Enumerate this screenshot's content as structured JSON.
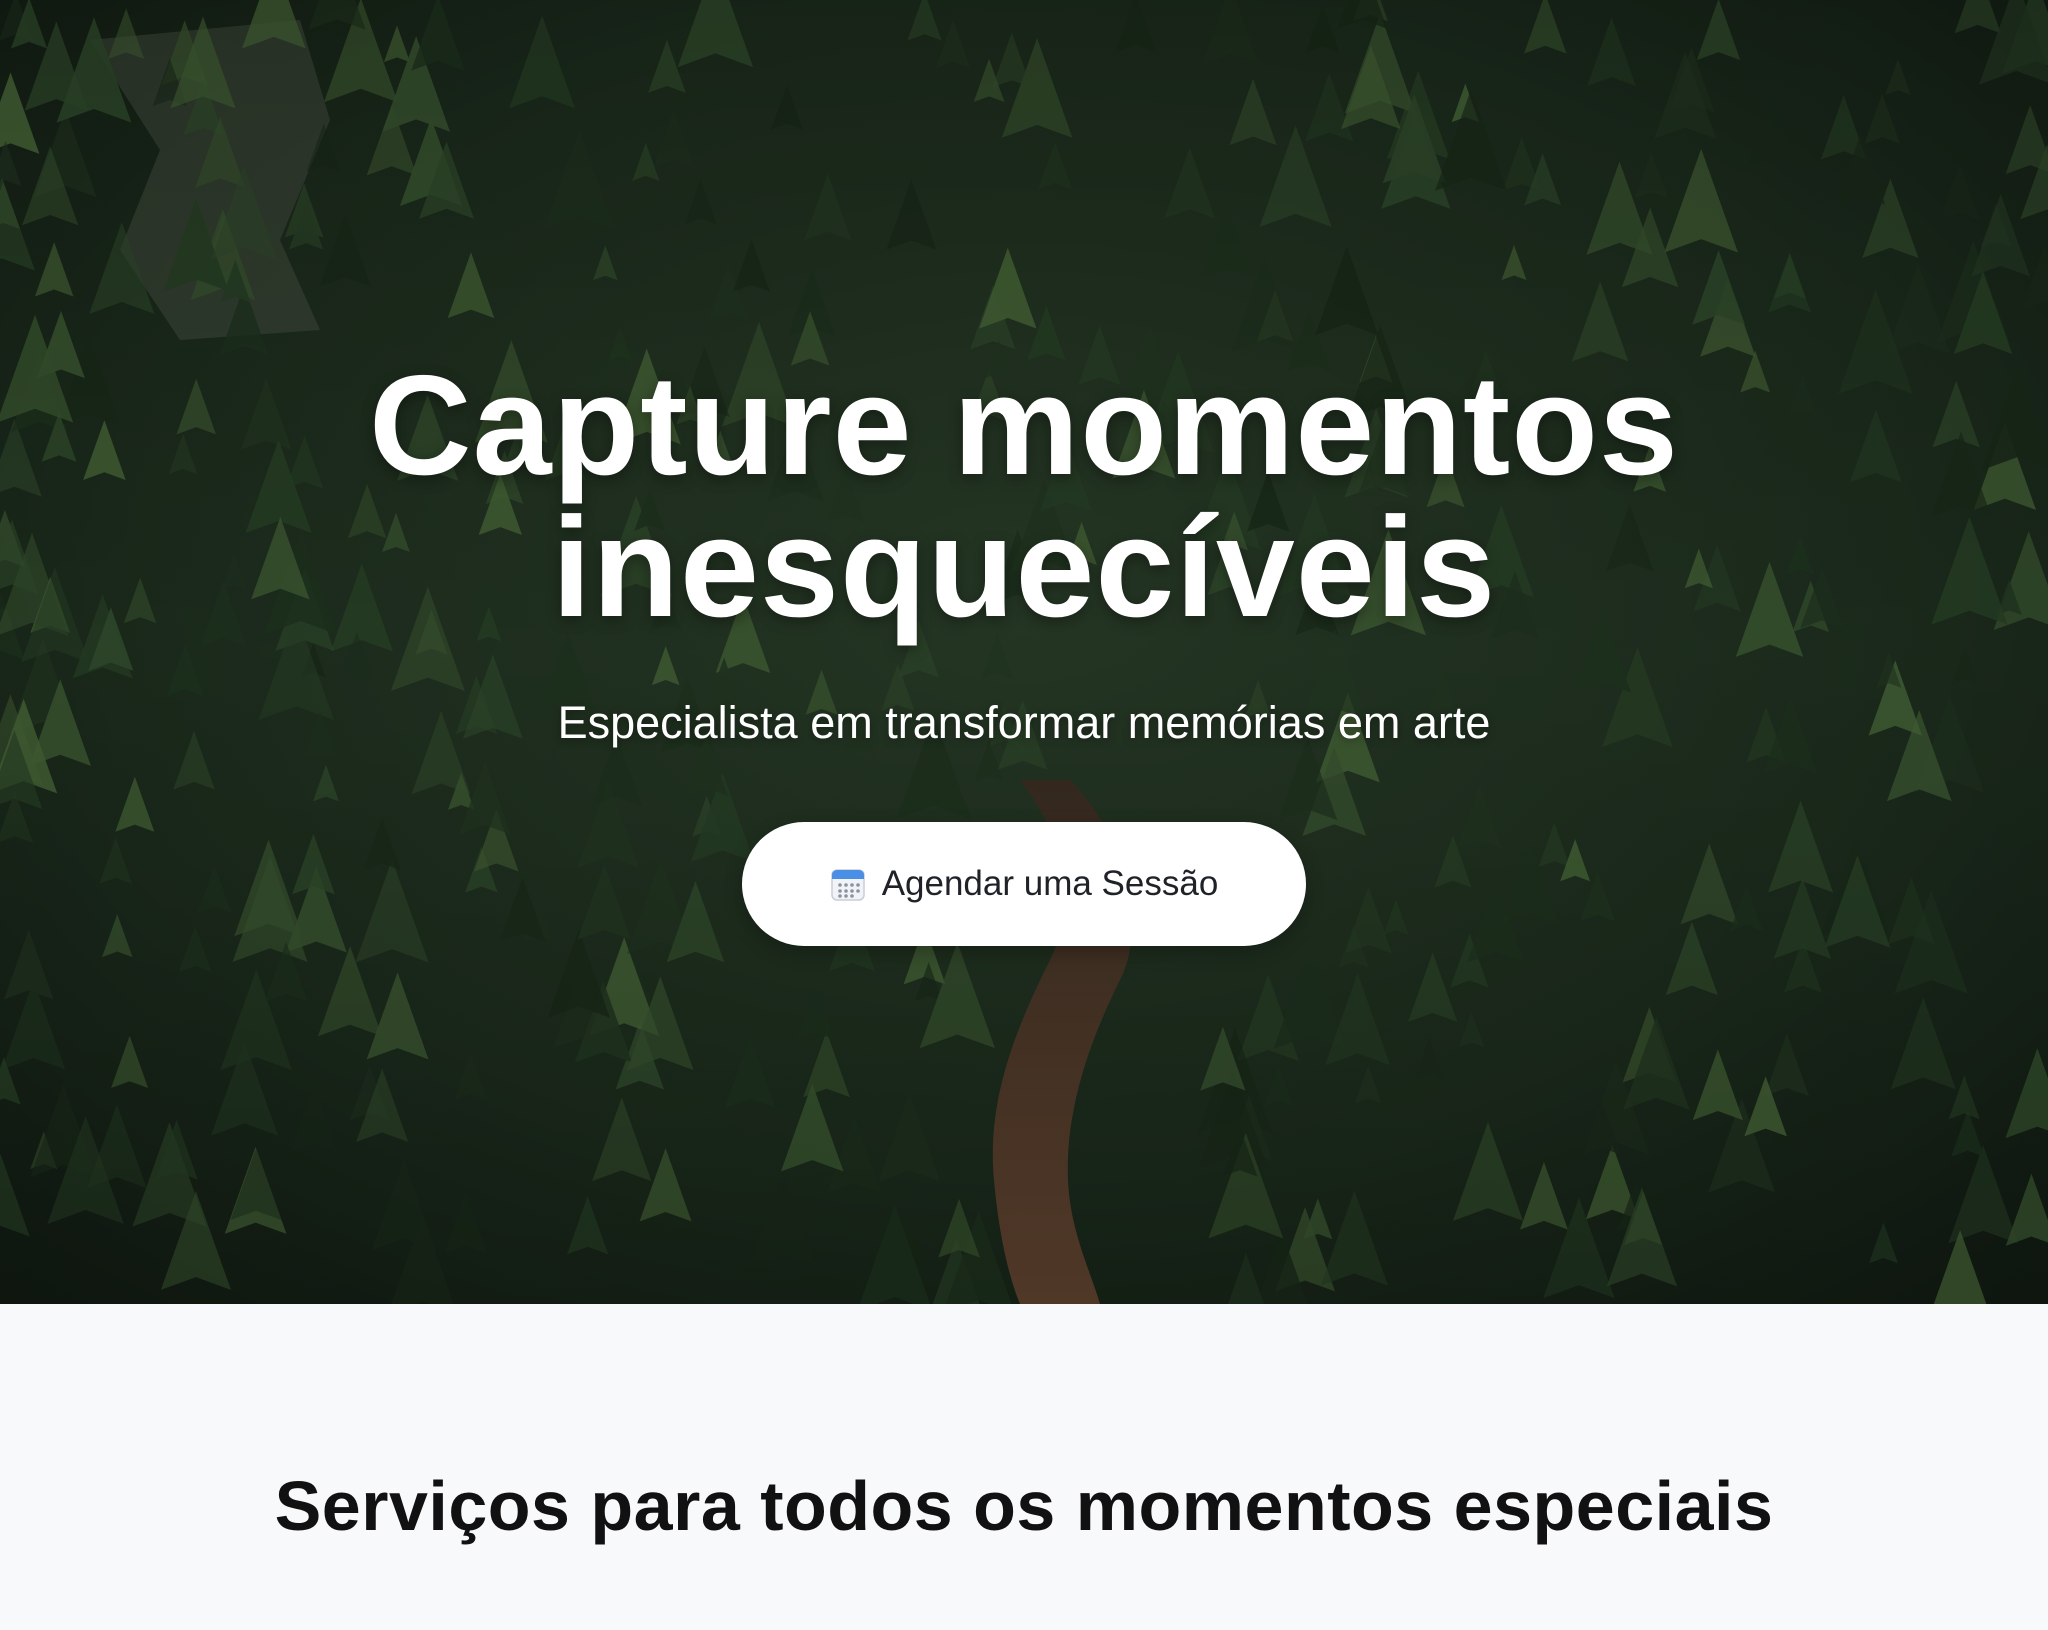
{
  "hero": {
    "title_line1": "Capture momentos",
    "title_line2": "inesquecíveis",
    "subtitle": "Especialista em transformar memórias em arte",
    "cta": {
      "label": "Agendar uma Sessão",
      "icon": "calendar-icon"
    }
  },
  "services": {
    "title": "Serviços para todos os momentos especiais"
  },
  "colors": {
    "forest_dark": "#1a2a1c",
    "forest_mid": "#2f4a2e",
    "road": "#5a4030",
    "button_bg": "#ffffff",
    "services_bg": "#f8f9fb",
    "heading_text": "#111111"
  }
}
